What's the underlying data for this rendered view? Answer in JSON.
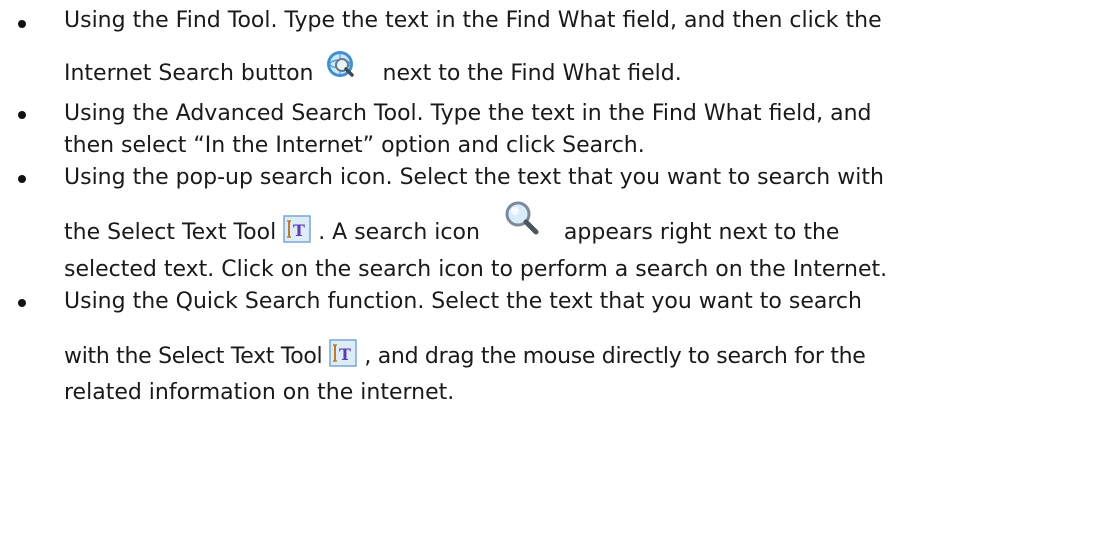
{
  "items": [
    {
      "text_1": "Using the Find Tool. Type the text in the Find What field, and then click the",
      "text_2a": "Internet Search button",
      "icon": "internet-search-icon",
      "text_2b": "next to the Find What field."
    },
    {
      "text_1": "Using the Advanced Search Tool. Type the text in the Find What field, and",
      "text_2": "then select “In the Internet” option and click Search."
    },
    {
      "text_1": "Using the pop-up search icon. Select the text that you want to search with",
      "text_2a": "the Select Text Tool",
      "icon_1": "select-text-tool-icon",
      "text_2b": ". A search icon",
      "icon_2": "search-magnifier-icon",
      "text_2c": "appears right next to the",
      "text_3": "selected text. Click on the search icon to perform a search on the Internet."
    },
    {
      "text_1": "Using the Quick Search function. Select the text that you want to search",
      "text_2a": "with the Select Text Tool",
      "icon": "select-text-tool-icon",
      "text_2b": ", and drag the mouse directly to search for the",
      "text_3": "related information on the internet."
    }
  ]
}
